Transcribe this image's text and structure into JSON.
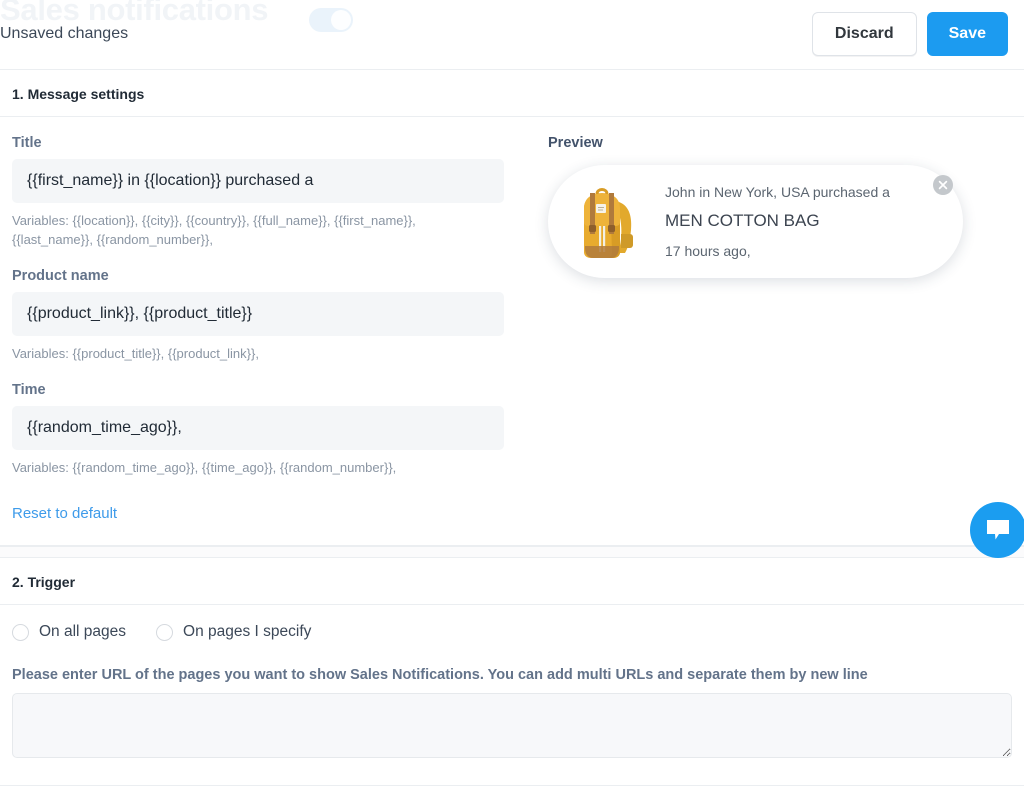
{
  "topbar": {
    "ghost_title": "Sales notifications",
    "toggle_state": "on",
    "unsaved_text": "Unsaved changes",
    "discard_label": "Discard",
    "save_label": "Save",
    "save_color": "#1c9bf0"
  },
  "section_message": {
    "heading": "1. Message settings",
    "fields": [
      {
        "label": "Title",
        "value": "{{first_name}} in {{location}} purchased a",
        "variables": "Variables: {{location}}, {{city}}, {{country}}, {{full_name}}, {{first_name}}, {{last_name}}, {{random_number}},"
      },
      {
        "label": "Product name",
        "value": "{{product_link}}, {{product_title}}",
        "variables": "Variables: {{product_title}}, {{product_link}},"
      },
      {
        "label": "Time",
        "value": "{{random_time_ago}},",
        "variables": "Variables: {{random_time_ago}}, {{time_ago}}, {{random_number}},"
      }
    ],
    "reset_label": "Reset to default",
    "preview": {
      "label": "Preview",
      "line1": "John in New York, USA purchased a",
      "line2": "MEN COTTON BAG",
      "line3": "17 hours ago,",
      "thumb_alt": "backpack-product-image",
      "close_icon": "close-icon"
    }
  },
  "section_trigger": {
    "heading": "2. Trigger",
    "options": [
      {
        "label": "On all pages",
        "selected": false
      },
      {
        "label": "On pages I specify",
        "selected": false
      }
    ],
    "url_help": "Please enter URL of the pages you want to show Sales Notifications. You can add multi URLs and separate them by new line",
    "url_value": "",
    "url_placeholder": ""
  },
  "chat_widget": {
    "icon": "chat-bubble-icon",
    "color": "#1b9df0"
  }
}
